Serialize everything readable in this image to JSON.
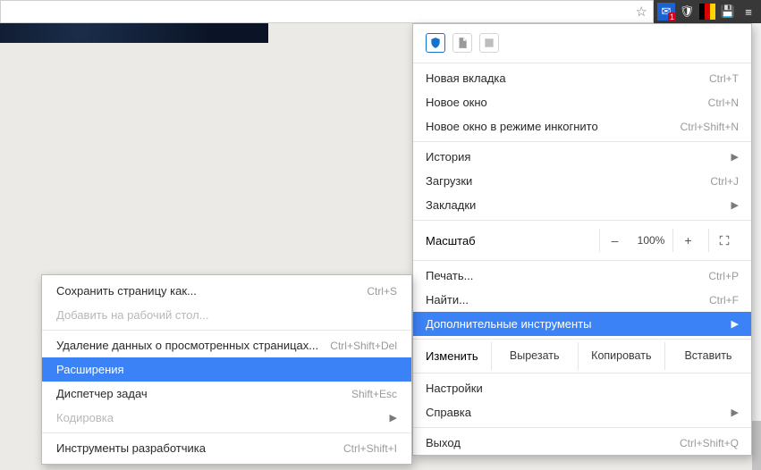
{
  "toolbar": {
    "extensions": {
      "mail_badge": "1"
    }
  },
  "apps": [
    {
      "name": "shield-app"
    },
    {
      "name": "pdf-app"
    },
    {
      "name": "generic-app"
    }
  ],
  "menu": {
    "new_tab": {
      "label": "Новая вкладка",
      "shortcut": "Ctrl+T"
    },
    "new_window": {
      "label": "Новое окно",
      "shortcut": "Ctrl+N"
    },
    "incognito": {
      "label": "Новое окно в режиме инкогнито",
      "shortcut": "Ctrl+Shift+N"
    },
    "history": {
      "label": "История"
    },
    "downloads": {
      "label": "Загрузки",
      "shortcut": "Ctrl+J"
    },
    "bookmarks": {
      "label": "Закладки"
    },
    "zoom": {
      "label": "Масштаб",
      "minus": "–",
      "value": "100%",
      "plus": "+"
    },
    "print": {
      "label": "Печать...",
      "shortcut": "Ctrl+P"
    },
    "find": {
      "label": "Найти...",
      "shortcut": "Ctrl+F"
    },
    "more_tools": {
      "label": "Дополнительные инструменты"
    },
    "edit": {
      "label": "Изменить",
      "cut": "Вырезать",
      "copy": "Копировать",
      "paste": "Вставить"
    },
    "settings": {
      "label": "Настройки"
    },
    "help": {
      "label": "Справка"
    },
    "exit": {
      "label": "Выход",
      "shortcut": "Ctrl+Shift+Q"
    }
  },
  "submenu": {
    "save_as": {
      "label": "Сохранить страницу как...",
      "shortcut": "Ctrl+S"
    },
    "add_to_desktop": {
      "label": "Добавить на рабочий стол..."
    },
    "clear_data": {
      "label": "Удаление данных о просмотренных страницах...",
      "shortcut": "Ctrl+Shift+Del"
    },
    "extensions": {
      "label": "Расширения"
    },
    "task_manager": {
      "label": "Диспетчер задач",
      "shortcut": "Shift+Esc"
    },
    "encoding": {
      "label": "Кодировка"
    },
    "dev_tools": {
      "label": "Инструменты разработчика",
      "shortcut": "Ctrl+Shift+I"
    }
  }
}
